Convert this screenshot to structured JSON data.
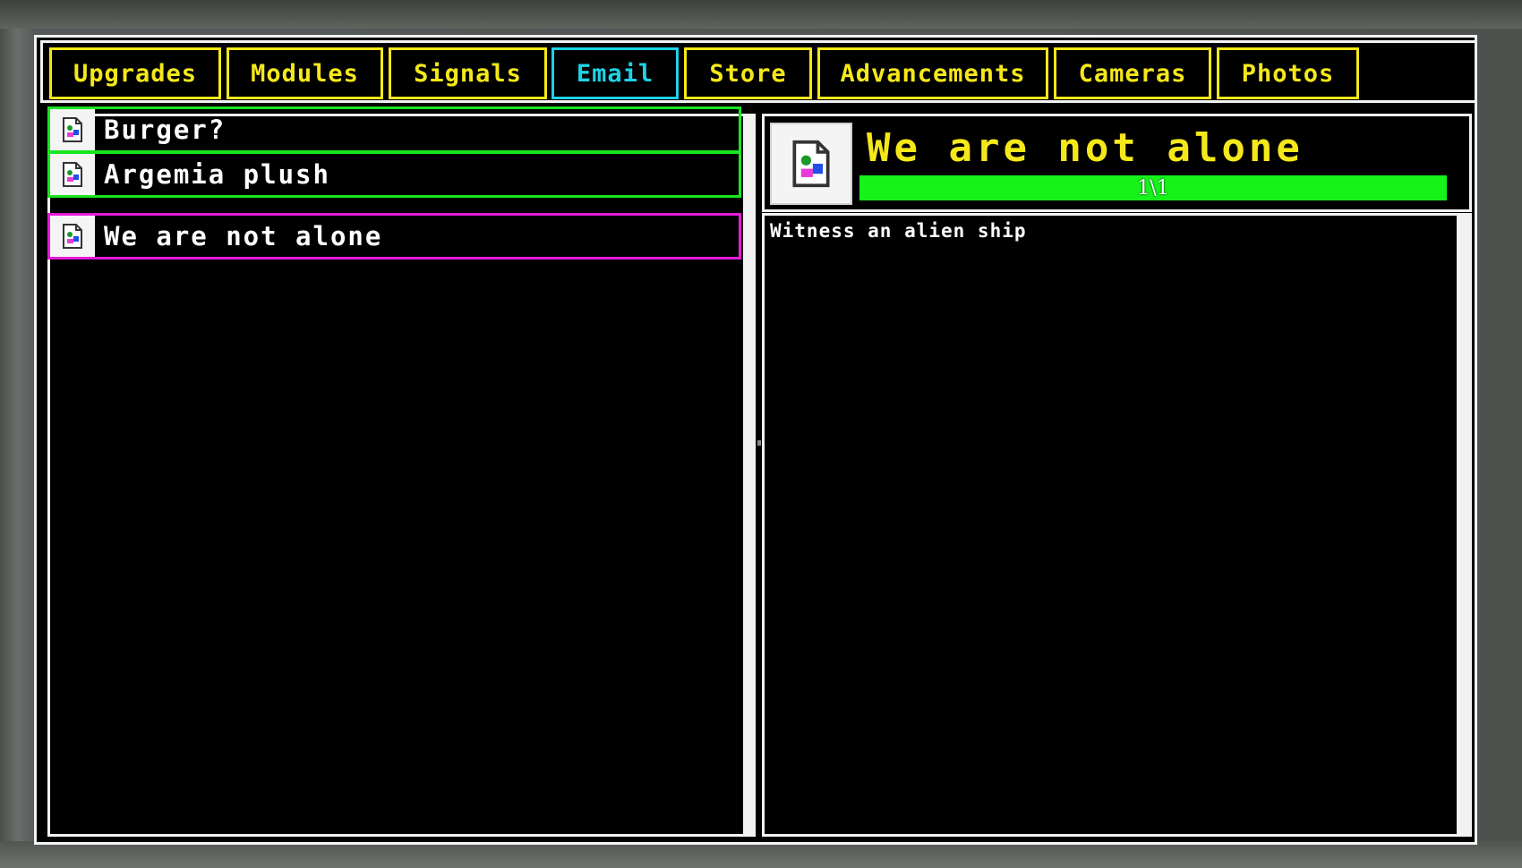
{
  "tabs": [
    {
      "label": "Upgrades",
      "active": false
    },
    {
      "label": "Modules",
      "active": false
    },
    {
      "label": "Signals",
      "active": false
    },
    {
      "label": "Email",
      "active": true
    },
    {
      "label": "Store",
      "active": false
    },
    {
      "label": "Advancements",
      "active": false
    },
    {
      "label": "Cameras",
      "active": false
    },
    {
      "label": "Photos",
      "active": false
    }
  ],
  "email_list": [
    {
      "subject": "Burger?",
      "icon": "missing-image-icon",
      "selected": false
    },
    {
      "subject": "Argemia plush",
      "icon": "missing-image-icon",
      "selected": false
    },
    {
      "subject": "We are not alone",
      "icon": "missing-image-icon",
      "selected": true
    }
  ],
  "detail": {
    "title": "We are not alone",
    "icon": "missing-image-icon",
    "progress_text": "1\\1",
    "progress_fraction": 1.0,
    "description": "Witness an alien ship"
  },
  "colors": {
    "tab_border": "#f5e81a",
    "tab_active": "#1fd2e6",
    "item_border": "#18e620",
    "item_selected_border": "#e61ad8",
    "progress_fill": "#17f21b",
    "title": "#f5e81a"
  }
}
